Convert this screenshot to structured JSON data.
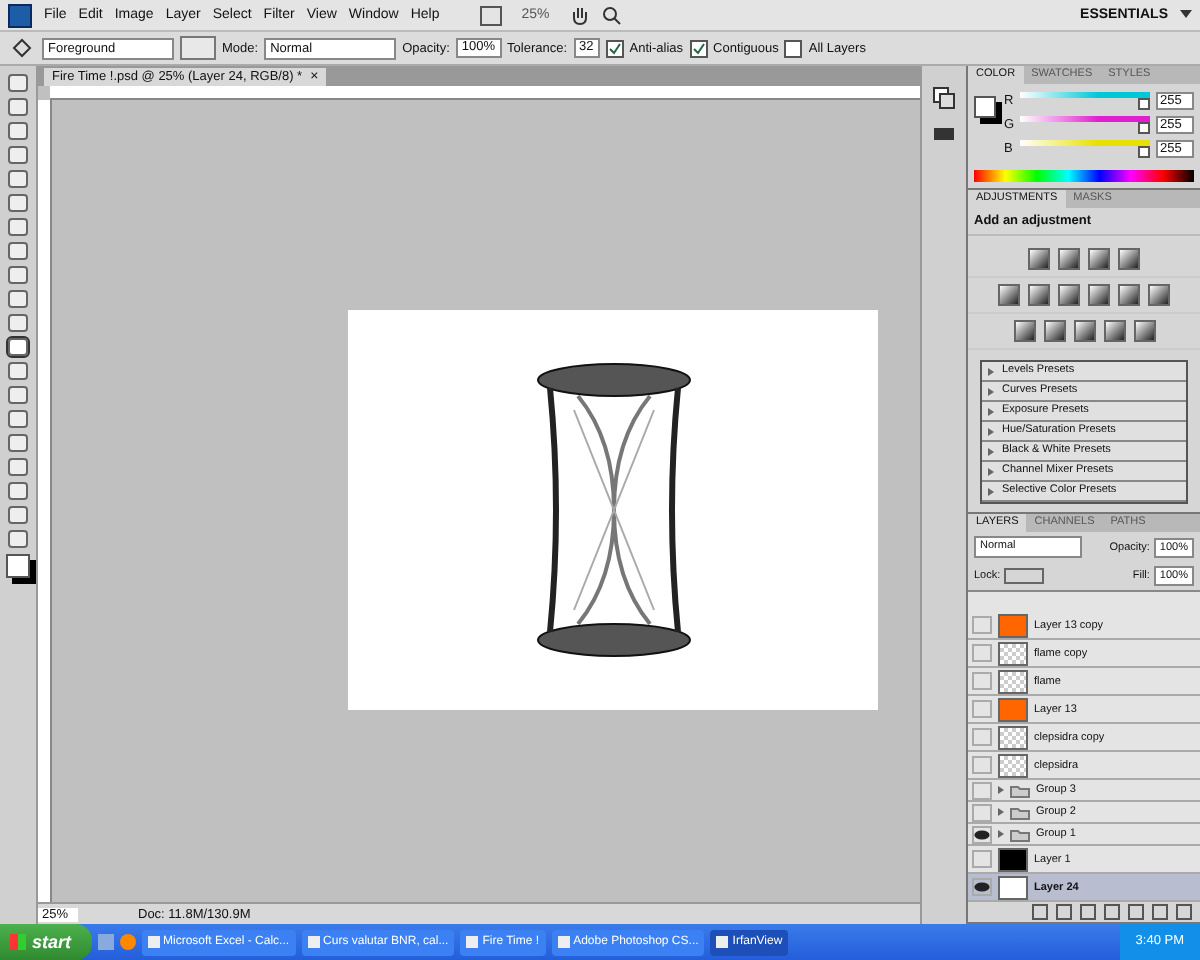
{
  "menu": {
    "items": [
      "File",
      "Edit",
      "Image",
      "Layer",
      "Select",
      "Filter",
      "View",
      "Window",
      "Help"
    ],
    "zoom": "25%",
    "workspace": "ESSENTIALS"
  },
  "options": {
    "fill_source": "Foreground",
    "mode_label": "Mode:",
    "mode": "Normal",
    "opacity_label": "Opacity:",
    "opacity": "100%",
    "tolerance_label": "Tolerance:",
    "tolerance": "32",
    "checks": [
      {
        "label": "Anti-alias",
        "checked": true
      },
      {
        "label": "Contiguous",
        "checked": true
      },
      {
        "label": "All Layers",
        "checked": false
      }
    ]
  },
  "tools": [
    {
      "selected": false
    },
    {
      "selected": false
    },
    {
      "selected": false
    },
    {
      "selected": false
    },
    {
      "selected": false
    },
    {
      "selected": false
    },
    {
      "selected": false
    },
    {
      "selected": false
    },
    {
      "selected": false
    },
    {
      "selected": false
    },
    {
      "selected": false
    },
    {
      "selected": true
    },
    {
      "selected": false
    },
    {
      "selected": false
    },
    {
      "selected": false
    },
    {
      "selected": false
    },
    {
      "selected": false
    },
    {
      "selected": false
    },
    {
      "selected": false
    },
    {
      "selected": false
    }
  ],
  "document": {
    "tab_title": "Fire Time !.psd @ 25% (Layer 24, RGB/8) *",
    "close": "×",
    "zoom": "25%",
    "doc_size": "Doc: 11.8M/130.9M"
  },
  "color_panel": {
    "tabs": [
      {
        "label": "COLOR",
        "selected": true
      },
      {
        "label": "SWATCHES",
        "selected": false
      },
      {
        "label": "STYLES",
        "selected": false
      }
    ],
    "channels": [
      {
        "name": "R",
        "level": 1.0,
        "value": "255",
        "color": "#00c8d8"
      },
      {
        "name": "G",
        "level": 1.0,
        "value": "255",
        "color": "#e020d0"
      },
      {
        "name": "B",
        "level": 1.0,
        "value": "255",
        "color": "#e8e000"
      }
    ]
  },
  "adjustments_panel": {
    "tabs": [
      {
        "label": "ADJUSTMENTS",
        "selected": true
      },
      {
        "label": "MASKS",
        "selected": false
      }
    ],
    "heading": "Add an adjustment",
    "presets": [
      "Levels Presets",
      "Curves Presets",
      "Exposure Presets",
      "Hue/Saturation Presets",
      "Black & White Presets",
      "Channel Mixer Presets",
      "Selective Color Presets"
    ]
  },
  "layers_panel": {
    "tabs": [
      {
        "label": "LAYERS",
        "selected": true
      },
      {
        "label": "CHANNELS",
        "selected": false
      },
      {
        "label": "PATHS",
        "selected": false
      }
    ],
    "blend_mode": "Normal",
    "opacity_label": "Opacity:",
    "opacity": "100%",
    "lock_label": "Lock:",
    "fill_label": "Fill:",
    "fill": "100%",
    "layers": [
      {
        "name": "Layer 13 copy",
        "kind": "orange",
        "visible": false,
        "selected": false
      },
      {
        "name": "flame copy",
        "kind": "transparent",
        "visible": false,
        "selected": false
      },
      {
        "name": "flame",
        "kind": "transparent",
        "visible": false,
        "selected": false
      },
      {
        "name": "Layer 13",
        "kind": "orange",
        "visible": false,
        "selected": false
      },
      {
        "name": "clepsidra copy",
        "kind": "transparent",
        "visible": false,
        "selected": false
      },
      {
        "name": "clepsidra",
        "kind": "transparent",
        "visible": false,
        "selected": false
      },
      {
        "name": "Group 3",
        "kind": "group",
        "visible": false,
        "selected": false
      },
      {
        "name": "Group 2",
        "kind": "group",
        "visible": false,
        "selected": false
      },
      {
        "name": "Group 1",
        "kind": "group",
        "visible": true,
        "selected": false
      },
      {
        "name": "Layer 1",
        "kind": "black",
        "visible": false,
        "selected": false
      },
      {
        "name": "Layer 24",
        "kind": "white",
        "visible": true,
        "selected": true
      }
    ]
  },
  "taskbar": {
    "start": "start",
    "tasks": [
      {
        "label": "Microsoft Excel - Calc...",
        "selected": false
      },
      {
        "label": "Curs valutar BNR, cal...",
        "selected": false
      },
      {
        "label": "Fire Time !",
        "selected": false
      },
      {
        "label": "Adobe Photoshop CS...",
        "selected": false
      },
      {
        "label": "IrfanView",
        "selected": true
      }
    ],
    "clock": "3:40 PM"
  }
}
